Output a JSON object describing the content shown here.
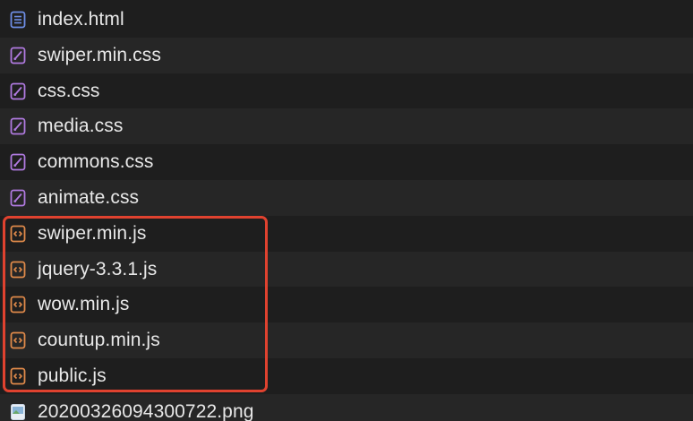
{
  "files": [
    {
      "name": "index.html",
      "icon": "html-file-icon",
      "color": "#6e8ee6"
    },
    {
      "name": "swiper.min.css",
      "icon": "css-file-icon",
      "color": "#b07ae0"
    },
    {
      "name": "css.css",
      "icon": "css-file-icon",
      "color": "#b07ae0"
    },
    {
      "name": "media.css",
      "icon": "css-file-icon",
      "color": "#b07ae0"
    },
    {
      "name": "commons.css",
      "icon": "css-file-icon",
      "color": "#b07ae0"
    },
    {
      "name": "animate.css",
      "icon": "css-file-icon",
      "color": "#b07ae0"
    },
    {
      "name": "swiper.min.js",
      "icon": "js-file-icon",
      "color": "#e08a4a"
    },
    {
      "name": "jquery-3.3.1.js",
      "icon": "js-file-icon",
      "color": "#e08a4a"
    },
    {
      "name": "wow.min.js",
      "icon": "js-file-icon",
      "color": "#e08a4a"
    },
    {
      "name": "countup.min.js",
      "icon": "js-file-icon",
      "color": "#e08a4a"
    },
    {
      "name": "public.js",
      "icon": "js-file-icon",
      "color": "#e08a4a"
    },
    {
      "name": "20200326094300722.png",
      "icon": "image-file-icon",
      "color": "#8ab4d8"
    }
  ],
  "highlight": {
    "color": "#e0422f"
  }
}
